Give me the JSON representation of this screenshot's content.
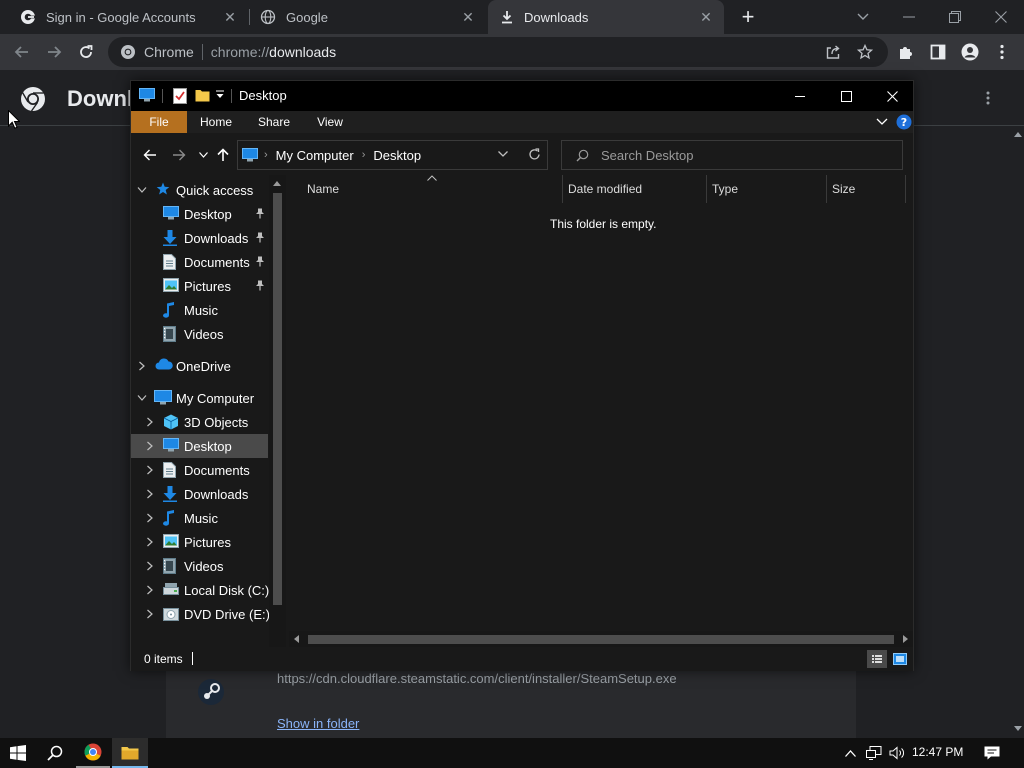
{
  "browser": {
    "tabs": [
      {
        "title": "Sign in - Google Accounts",
        "icon": "google-g-icon",
        "active": false
      },
      {
        "title": "Google",
        "icon": "globe-icon",
        "active": false
      },
      {
        "title": "Downloads",
        "icon": "download-icon",
        "active": true
      }
    ],
    "new_tab_label": "+",
    "omnibox": {
      "chip_label": "Chrome",
      "url_prefix": "chrome://",
      "url_path": "downloads"
    }
  },
  "downloads_page": {
    "title": "Downl",
    "item_url": "https://cdn.cloudflare.steamstatic.com/client/installer/SteamSetup.exe",
    "show_in_folder": "Show in folder"
  },
  "explorer": {
    "title": "Desktop",
    "ribbon_tabs": [
      "File",
      "Home",
      "Share",
      "View"
    ],
    "breadcrumb": [
      "My Computer",
      "Desktop"
    ],
    "search_placeholder": "Search Desktop",
    "columns": [
      "Name",
      "Date modified",
      "Type",
      "Size"
    ],
    "empty_message": "This folder is empty.",
    "status": "0 items",
    "nav": {
      "quick_access": {
        "label": "Quick access",
        "items": [
          "Desktop",
          "Downloads",
          "Documents",
          "Pictures",
          "Music",
          "Videos"
        ]
      },
      "onedrive": "OneDrive",
      "my_computer": {
        "label": "My Computer",
        "items": [
          "3D Objects",
          "Desktop",
          "Documents",
          "Downloads",
          "Music",
          "Pictures",
          "Videos",
          "Local Disk (C:)",
          "DVD Drive (E:) In"
        ]
      }
    },
    "selected_nav_item": "Desktop"
  },
  "taskbar": {
    "time": "12:47 PM"
  },
  "colors": {
    "accent_file_tab": "#b5701f",
    "link": "#8ab4f8",
    "chrome_dark": "#202124",
    "chrome_toolbar": "#35363a"
  }
}
